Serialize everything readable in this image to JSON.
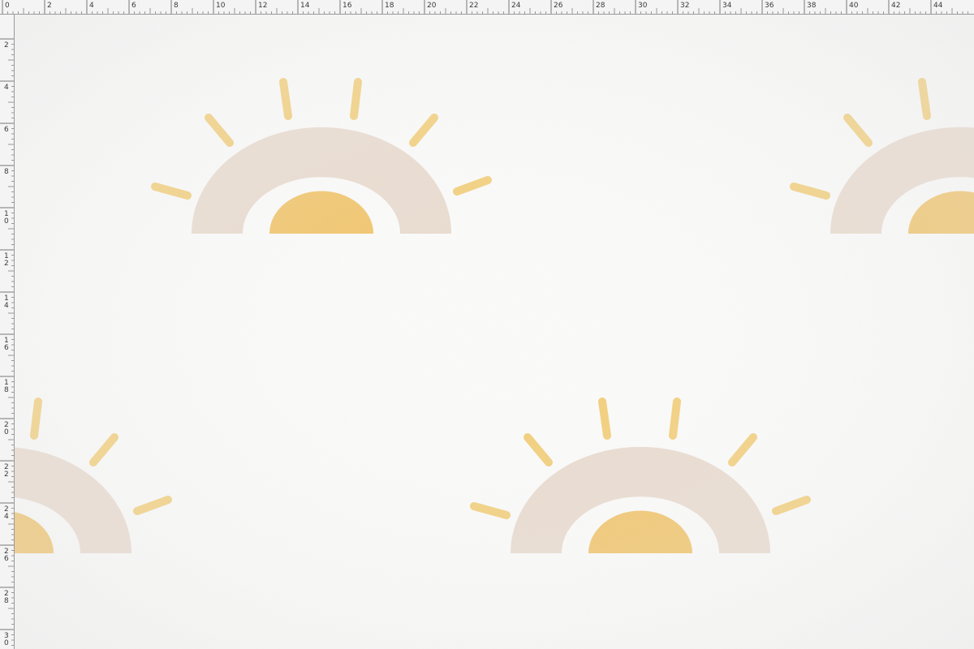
{
  "ruler_top": {
    "labels": [
      "0",
      "2",
      "4",
      "6",
      "8",
      "10",
      "12",
      "14",
      "16",
      "18",
      "20",
      "22",
      "24",
      "26",
      "28",
      "30",
      "32",
      "34",
      "36",
      "38",
      "40",
      "42",
      "44"
    ]
  },
  "ruler_left": {
    "labels": [
      "2",
      "4",
      "6",
      "8",
      "10",
      "12",
      "14",
      "16",
      "18",
      "20",
      "22",
      "24",
      "26",
      "28",
      "30"
    ]
  },
  "colors": {
    "arch": "#e8d9cc",
    "sun": "#f0c060",
    "ray": "#f2cc72",
    "fabric": "#fbfbfa"
  },
  "pattern": {
    "motif": "half-sun-rainbow-icon"
  }
}
